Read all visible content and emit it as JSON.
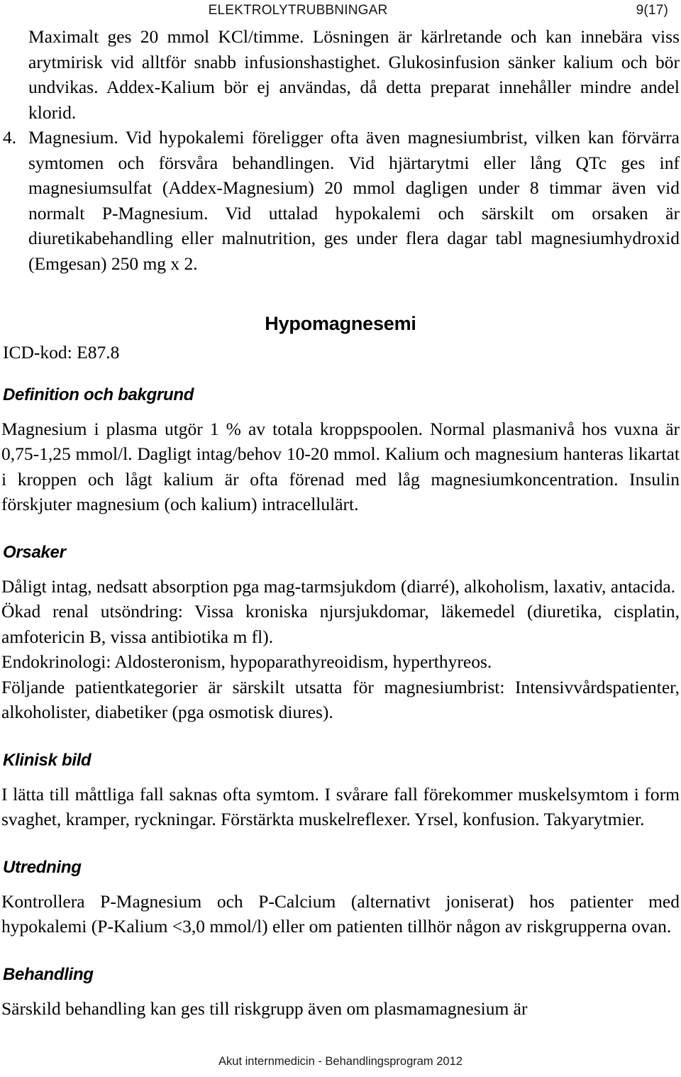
{
  "header": {
    "title": "ELEKTROLYTRUBBNINGAR",
    "page_number": "9(17)"
  },
  "intro_block": {
    "paragraph_continued": "Maximalt ges 20 mmol KCl/timme. Lösningen är kärlretande och kan innebära viss arytmirisk vid alltför snabb infusionshastighet. Glukosinfusion sänker kalium och bör undvikas. Addex-Kalium bör ej användas, då detta preparat innehåller mindre andel klorid.",
    "item_marker": "4.",
    "item_text": "Magnesium. Vid hypokalemi föreligger ofta även magnesiumbrist, vilken kan förvärra symtomen och försvåra behandlingen. Vid hjärtarytmi eller lång QTc ges inf magnesiumsulfat (Addex-Magnesium) 20 mmol dagligen under 8 timmar även vid normalt P-Magnesium. Vid uttalad hypokalemi och särskilt om orsaken är diuretikabehandling eller malnutrition, ges under flera dagar tabl magnesiumhydroxid (Emgesan) 250 mg x 2."
  },
  "chapter": {
    "title": "Hypomagnesemi",
    "icd_code": "ICD-kod: E87.8"
  },
  "sections": [
    {
      "heading": "Definition och bakgrund",
      "paragraphs": [
        "Magnesium i plasma utgör 1 % av totala kroppspoolen. Normal plasmanivå hos vuxna är 0,75-1,25 mmol/l. Dagligt intag/behov 10-20 mmol. Kalium och magnesium hanteras likartat i kroppen och lågt kalium är ofta förenad med låg magnesiumkoncentration. Insulin förskjuter magnesium (och kalium) intracellulärt."
      ]
    },
    {
      "heading": "Orsaker",
      "paragraphs": [
        "Dåligt intag, nedsatt absorption pga mag-tarmsjukdom (diarré), alkoholism, laxativ, antacida.",
        "Ökad renal utsöndring: Vissa kroniska njursjukdomar, läkemedel (diuretika, cisplatin, amfotericin B, vissa antibiotika m fl).",
        "Endokrinologi: Aldosteronism, hypoparathyreoidism, hyperthyreos.",
        "Följande patientkategorier är särskilt utsatta för magnesiumbrist: Intensivvårdspatienter, alkoholister, diabetiker (pga osmotisk diures)."
      ]
    },
    {
      "heading": "Klinisk bild",
      "paragraphs": [
        "I lätta till måttliga fall saknas ofta symtom. I svårare fall förekommer muskelsymtom i form svaghet, kramper, ryckningar. Förstärkta muskelreflexer. Yrsel, konfusion. Takyarytmier."
      ]
    },
    {
      "heading": "Utredning",
      "paragraphs": [
        "Kontrollera P-Magnesium och P-Calcium (alternativt joniserat) hos patienter med hypokalemi (P-Kalium <3,0 mmol/l) eller om patienten tillhör någon av riskgrupperna ovan."
      ]
    },
    {
      "heading": "Behandling",
      "paragraphs": [
        "Särskild behandling kan ges till riskgrupp även om plasmamagnesium är"
      ]
    }
  ],
  "footer": {
    "text": "Akut internmedicin - Behandlingsprogram 2012"
  }
}
